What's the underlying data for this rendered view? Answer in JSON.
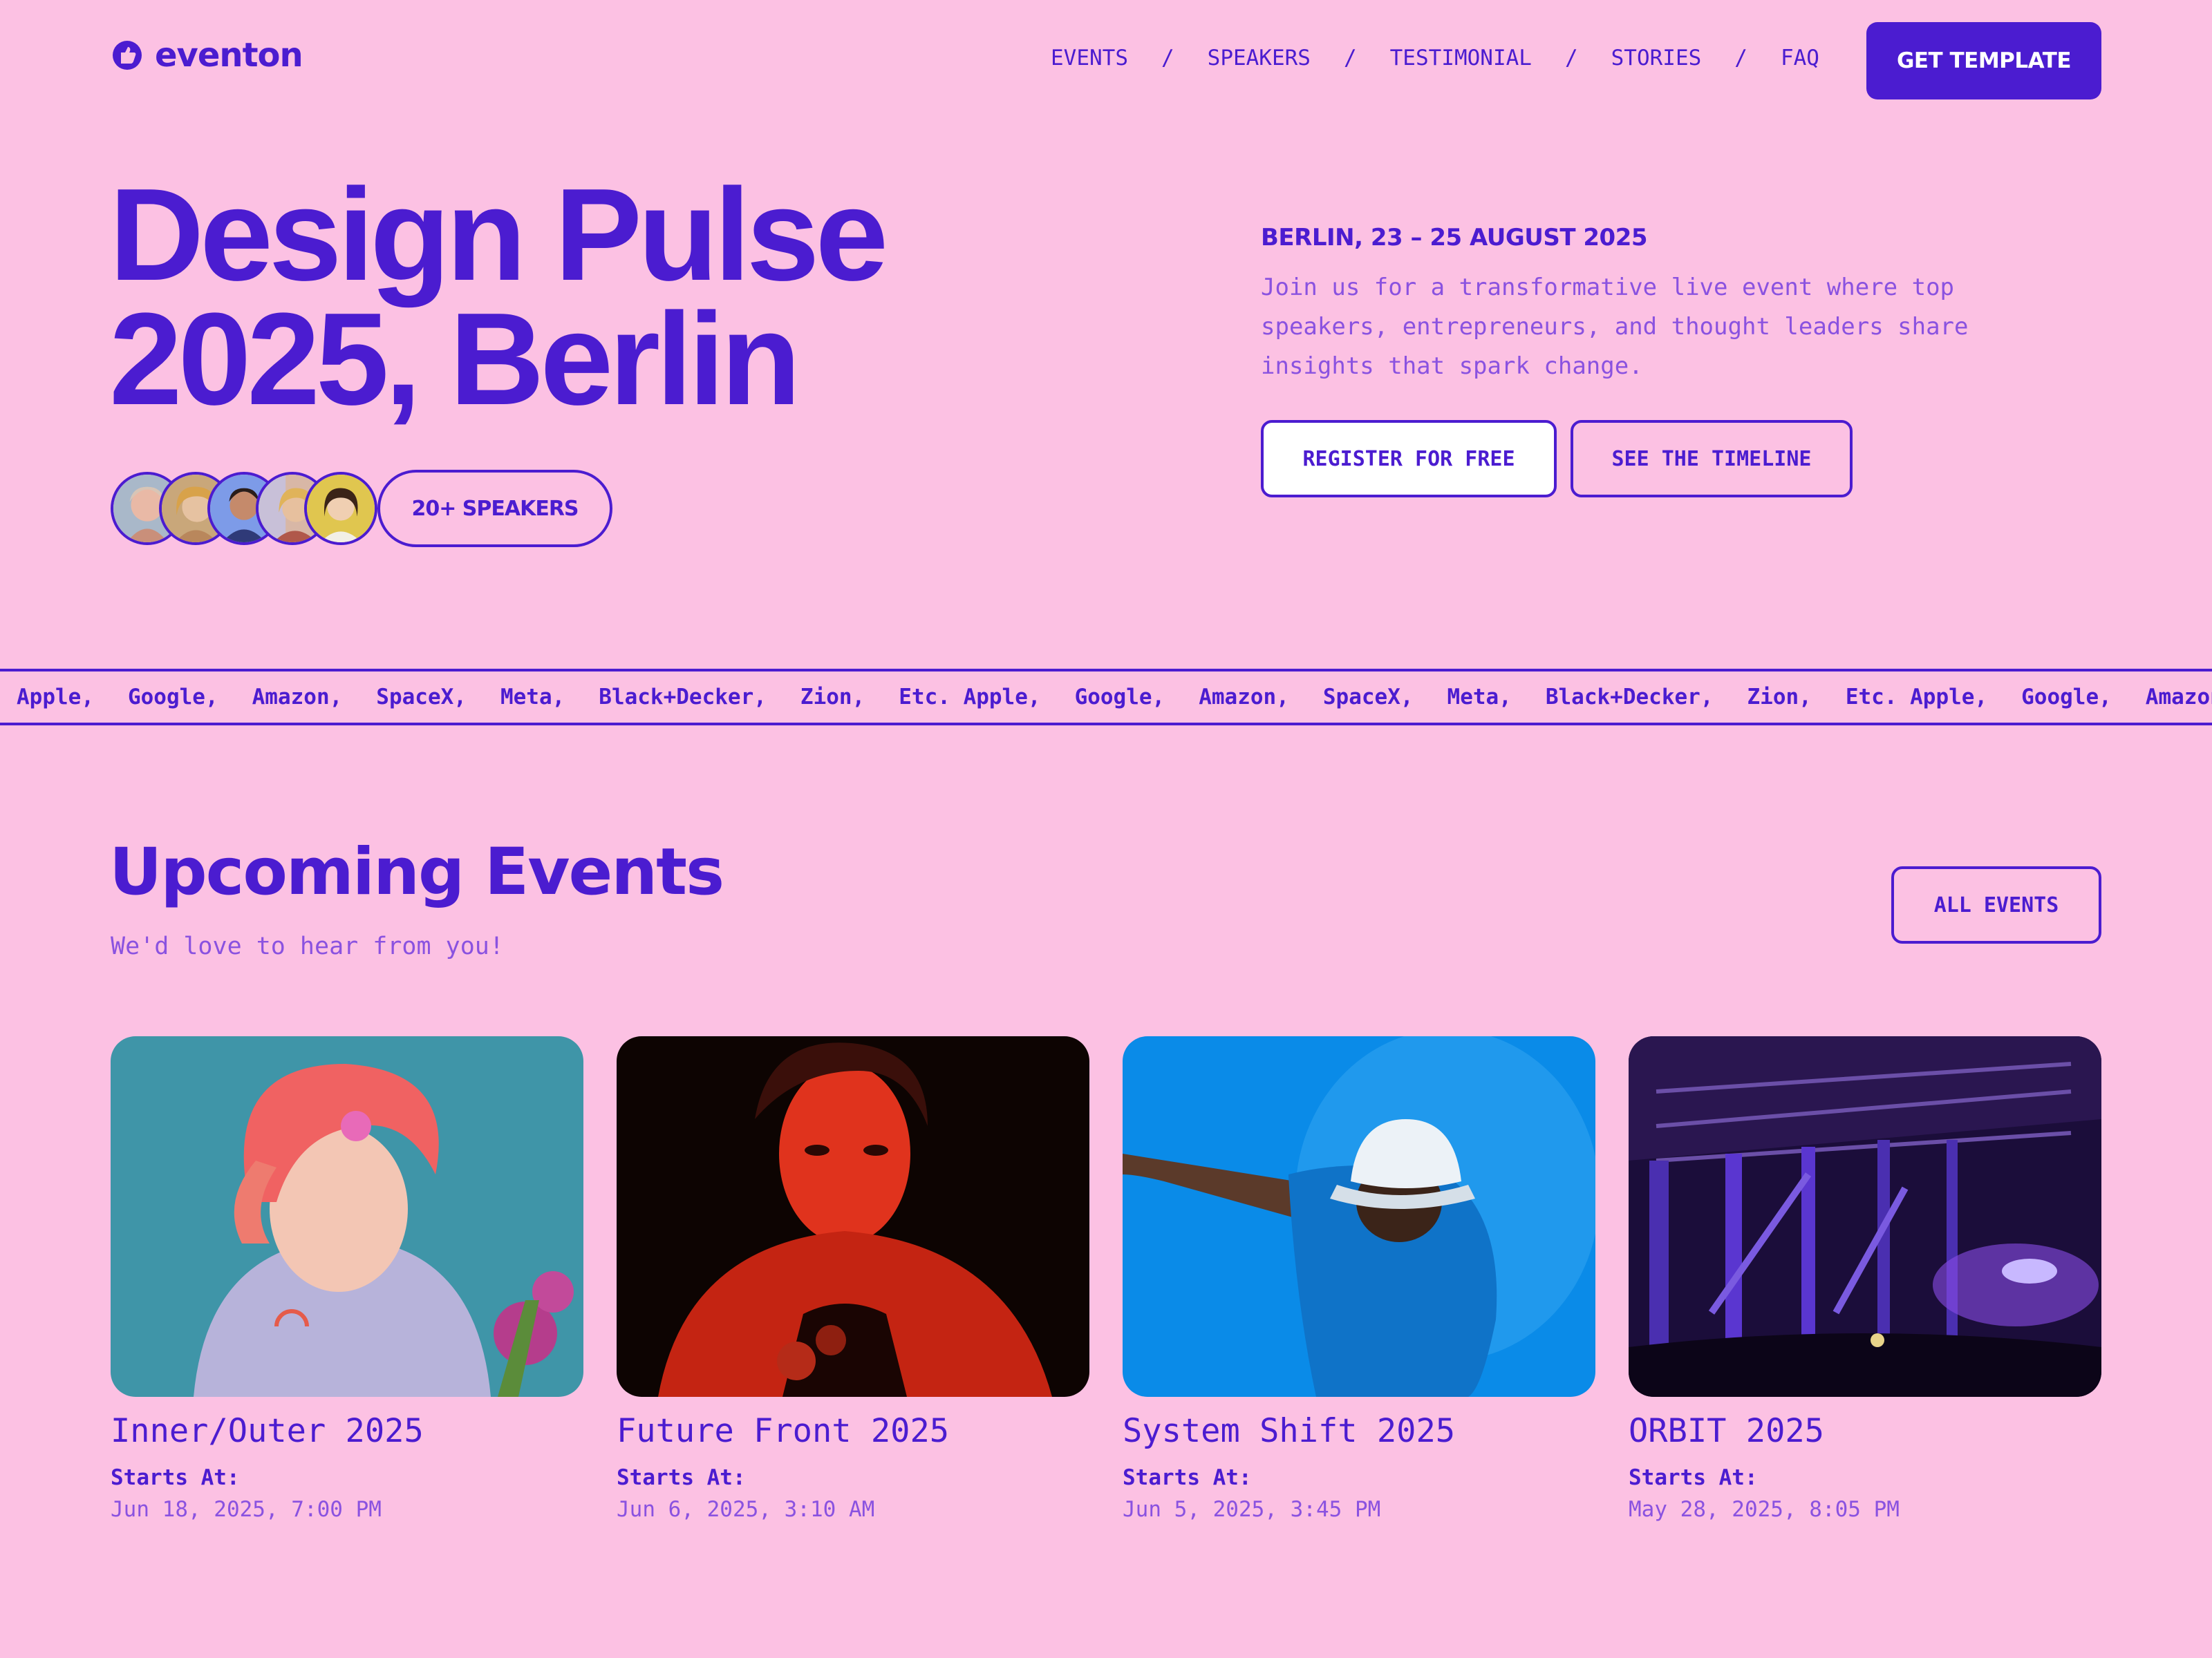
{
  "header": {
    "brand": "eventon",
    "nav": [
      "EVENTS",
      "SPEAKERS",
      "TESTIMONIAL",
      "STORIES",
      "FAQ"
    ],
    "nav_separator": "/",
    "cta": "GET TEMPLATE"
  },
  "hero": {
    "title_line1": "Design Pulse",
    "title_line2": "2025, Berlin",
    "speakers_pill": "20+ SPEAKERS",
    "date_location": "BERLIN, 23 – 25 AUGUST 2025",
    "description": "Join us for a transformative live event where top speakers, entrepreneurs, and thought leaders share insights that spark change.",
    "register_button": "REGISTER FOR FREE",
    "timeline_button": "SEE THE TIMELINE"
  },
  "marquee": {
    "items": [
      "Apple,",
      "Google,",
      "Amazon,",
      "SpaceX,",
      "Meta,",
      "Black+Decker,",
      "Zion,",
      "Etc. Apple,",
      "Google,",
      "Amazon,",
      "SpaceX,",
      "Meta,",
      "Black+Decker,",
      "Zion,",
      "Etc. Apple,",
      "Google,",
      "Amazon,"
    ]
  },
  "events": {
    "title": "Upcoming Events",
    "subtitle": "We'd love to hear from you!",
    "all_button": "ALL EVENTS",
    "cards": [
      {
        "title": "Inner/Outer 2025",
        "label": "Starts At:",
        "date": "Jun 18, 2025, 7:00 PM"
      },
      {
        "title": "Future Front 2025",
        "label": "Starts At:",
        "date": "Jun 6, 2025, 3:10 AM"
      },
      {
        "title": "System Shift 2025",
        "label": "Starts At:",
        "date": "Jun 5, 2025, 3:45 PM"
      },
      {
        "title": "ORBIT 2025",
        "label": "Starts At:",
        "date": "May 28, 2025, 8:05 PM"
      }
    ]
  },
  "colors": {
    "background": "#fcc1e3",
    "primary": "#4b1cd0",
    "muted_text": "#8a52e0",
    "white": "#ffffff"
  }
}
